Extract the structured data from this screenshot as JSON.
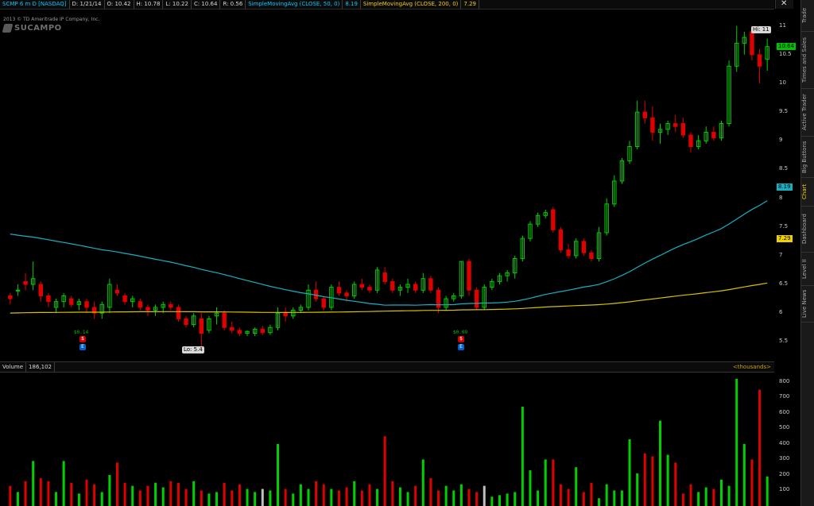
{
  "topbar": {
    "symbol": "SCMP 6 m D [NASDAQ]",
    "date": "D: 1/21/14",
    "open": "O: 10.42",
    "high": "H: 10.78",
    "low": "L: 10.22",
    "close": "C: 10.64",
    "range": "R: 0.56",
    "sma50_label": "SimpleMovingAvg (CLOSE, 50, 0)",
    "sma50_value": "8.19",
    "sma200_label": "SimpleMovingAvg (CLOSE, 200, 0)",
    "sma200_value": "7.29"
  },
  "copyright": "2013 © TD Ameritrade IP Company, Inc.",
  "logo_text": "SUCAMPO",
  "sidebar_tabs": [
    "Trade",
    "Times and Sales",
    "Active Trader",
    "Big Buttons",
    "Chart",
    "Dashboard",
    "Level II",
    "Live News"
  ],
  "price_axis": [
    "11",
    "10.5",
    "10",
    "9.5",
    "9",
    "8.5",
    "8",
    "7.5",
    "7",
    "6.5",
    "6",
    "5.5"
  ],
  "badges": {
    "last": "10.64",
    "sma50": "8.19",
    "sma200": "7.29"
  },
  "hi_label": "Hi: 11",
  "lo_label": "Lo: 5.4",
  "dividend_labels": [
    "$0.14",
    "$0.09"
  ],
  "volume_header": {
    "title": "Volume",
    "value": "186,102",
    "units": "<thousands>"
  },
  "volume_axis": [
    "800",
    "700",
    "600",
    "500",
    "400",
    "300",
    "200",
    "100"
  ],
  "colors": {
    "up": "#00d000",
    "down": "#e00000",
    "sma50": "#17b0c0",
    "sma200": "#d8c000",
    "neutral": "#bfbfbf"
  },
  "chart_data": {
    "type": "candlestick",
    "period": "6 m D",
    "ylim": [
      5.2,
      11.3
    ],
    "candles": [
      [
        6.3,
        6.35,
        6.15,
        6.25
      ],
      [
        6.4,
        6.5,
        6.3,
        6.4
      ],
      [
        6.55,
        6.7,
        6.4,
        6.5
      ],
      [
        6.5,
        6.9,
        6.4,
        6.6
      ],
      [
        6.5,
        6.55,
        6.2,
        6.3
      ],
      [
        6.3,
        6.35,
        6.1,
        6.2
      ],
      [
        6.1,
        6.25,
        6.0,
        6.2
      ],
      [
        6.2,
        6.35,
        6.1,
        6.3
      ],
      [
        6.25,
        6.3,
        6.1,
        6.15
      ],
      [
        6.15,
        6.25,
        6.05,
        6.2
      ],
      [
        6.2,
        6.25,
        6.0,
        6.1
      ],
      [
        6.1,
        6.2,
        5.9,
        6.0
      ],
      [
        6.0,
        6.2,
        5.9,
        6.15
      ],
      [
        6.1,
        6.6,
        6.0,
        6.5
      ],
      [
        6.4,
        6.5,
        6.3,
        6.35
      ],
      [
        6.3,
        6.35,
        6.15,
        6.2
      ],
      [
        6.2,
        6.3,
        6.1,
        6.25
      ],
      [
        6.2,
        6.25,
        6.05,
        6.1
      ],
      [
        6.1,
        6.15,
        5.95,
        6.05
      ],
      [
        6.05,
        6.15,
        5.95,
        6.1
      ],
      [
        6.1,
        6.2,
        6.0,
        6.15
      ],
      [
        6.15,
        6.2,
        6.05,
        6.1
      ],
      [
        6.1,
        6.15,
        5.85,
        5.9
      ],
      [
        5.9,
        5.95,
        5.75,
        5.8
      ],
      [
        5.8,
        6.0,
        5.75,
        5.95
      ],
      [
        5.9,
        6.0,
        5.4,
        5.65
      ],
      [
        5.7,
        5.95,
        5.65,
        5.9
      ],
      [
        5.95,
        6.1,
        5.8,
        6.0
      ],
      [
        6.0,
        6.05,
        5.7,
        5.75
      ],
      [
        5.75,
        5.85,
        5.65,
        5.7
      ],
      [
        5.7,
        5.75,
        5.6,
        5.65
      ],
      [
        5.65,
        5.7,
        5.6,
        5.68
      ],
      [
        5.65,
        5.75,
        5.6,
        5.72
      ],
      [
        5.72,
        5.78,
        5.62,
        5.66
      ],
      [
        5.66,
        5.8,
        5.62,
        5.75
      ],
      [
        5.75,
        6.1,
        5.7,
        6.0
      ],
      [
        6.0,
        6.1,
        5.85,
        5.95
      ],
      [
        5.95,
        6.1,
        5.9,
        6.05
      ],
      [
        6.05,
        6.15,
        6.0,
        6.1
      ],
      [
        6.1,
        6.5,
        6.05,
        6.4
      ],
      [
        6.4,
        6.55,
        6.2,
        6.25
      ],
      [
        6.25,
        6.3,
        6.05,
        6.1
      ],
      [
        6.1,
        6.5,
        6.05,
        6.45
      ],
      [
        6.45,
        6.55,
        6.3,
        6.35
      ],
      [
        6.35,
        6.4,
        6.2,
        6.3
      ],
      [
        6.3,
        6.55,
        6.25,
        6.5
      ],
      [
        6.5,
        6.6,
        6.4,
        6.45
      ],
      [
        6.45,
        6.5,
        6.35,
        6.4
      ],
      [
        6.4,
        6.8,
        6.35,
        6.75
      ],
      [
        6.7,
        6.8,
        6.5,
        6.55
      ],
      [
        6.55,
        6.6,
        6.35,
        6.4
      ],
      [
        6.4,
        6.5,
        6.3,
        6.45
      ],
      [
        6.45,
        6.6,
        6.35,
        6.5
      ],
      [
        6.5,
        6.55,
        6.35,
        6.4
      ],
      [
        6.4,
        6.7,
        6.35,
        6.6
      ],
      [
        6.6,
        6.65,
        6.35,
        6.4
      ],
      [
        6.4,
        6.45,
        6.0,
        6.1
      ],
      [
        6.1,
        6.3,
        6.05,
        6.25
      ],
      [
        6.25,
        6.35,
        6.2,
        6.3
      ],
      [
        6.3,
        6.9,
        6.25,
        6.9
      ],
      [
        6.9,
        6.95,
        6.3,
        6.4
      ],
      [
        6.4,
        6.45,
        6.05,
        6.1
      ],
      [
        6.1,
        6.5,
        6.05,
        6.45
      ],
      [
        6.45,
        6.6,
        6.4,
        6.55
      ],
      [
        6.55,
        6.7,
        6.5,
        6.65
      ],
      [
        6.65,
        6.75,
        6.55,
        6.7
      ],
      [
        6.7,
        7.0,
        6.6,
        6.95
      ],
      [
        6.95,
        7.35,
        6.9,
        7.3
      ],
      [
        7.3,
        7.6,
        7.25,
        7.55
      ],
      [
        7.55,
        7.75,
        7.5,
        7.7
      ],
      [
        7.7,
        7.8,
        7.65,
        7.75
      ],
      [
        7.8,
        7.85,
        7.4,
        7.45
      ],
      [
        7.45,
        7.5,
        7.05,
        7.1
      ],
      [
        7.1,
        7.2,
        6.95,
        7.0
      ],
      [
        7.0,
        7.3,
        6.95,
        7.25
      ],
      [
        7.25,
        7.3,
        7.0,
        7.05
      ],
      [
        7.05,
        7.1,
        6.9,
        6.95
      ],
      [
        6.95,
        7.5,
        6.9,
        7.4
      ],
      [
        7.4,
        8.0,
        7.35,
        7.9
      ],
      [
        7.9,
        8.4,
        7.85,
        8.3
      ],
      [
        8.3,
        8.7,
        8.25,
        8.65
      ],
      [
        8.65,
        9.0,
        8.6,
        8.9
      ],
      [
        8.9,
        9.7,
        8.85,
        9.5
      ],
      [
        9.5,
        9.7,
        9.3,
        9.4
      ],
      [
        9.4,
        9.6,
        9.0,
        9.15
      ],
      [
        9.15,
        9.3,
        8.95,
        9.2
      ],
      [
        9.2,
        9.35,
        9.1,
        9.3
      ],
      [
        9.3,
        9.45,
        9.15,
        9.25
      ],
      [
        9.3,
        9.4,
        9.05,
        9.1
      ],
      [
        9.1,
        9.15,
        8.8,
        8.9
      ],
      [
        8.9,
        9.1,
        8.85,
        9.0
      ],
      [
        9.0,
        9.25,
        8.95,
        9.15
      ],
      [
        9.15,
        9.25,
        9.0,
        9.05
      ],
      [
        9.05,
        9.35,
        9.0,
        9.3
      ],
      [
        9.3,
        10.4,
        9.25,
        10.3
      ],
      [
        10.3,
        11.0,
        10.2,
        10.7
      ],
      [
        10.7,
        10.9,
        10.5,
        10.8
      ],
      [
        10.9,
        11.0,
        10.4,
        10.5
      ],
      [
        10.5,
        10.6,
        10.0,
        10.3
      ],
      [
        10.42,
        10.78,
        10.22,
        10.64
      ]
    ],
    "volume_thousands": [
      130,
      90,
      160,
      290,
      180,
      160,
      90,
      290,
      150,
      80,
      170,
      140,
      90,
      200,
      280,
      150,
      130,
      100,
      130,
      150,
      120,
      160,
      150,
      110,
      160,
      100,
      80,
      90,
      150,
      100,
      140,
      110,
      90,
      110,
      100,
      400,
      110,
      80,
      140,
      110,
      160,
      140,
      110,
      100,
      120,
      160,
      100,
      140,
      110,
      450,
      160,
      120,
      90,
      130,
      300,
      180,
      100,
      130,
      100,
      140,
      110,
      90,
      130,
      60,
      70,
      80,
      90,
      640,
      230,
      100,
      300,
      300,
      140,
      110,
      250,
      90,
      150,
      50,
      140,
      100,
      100,
      430,
      210,
      340,
      320,
      550,
      330,
      280,
      80,
      140,
      90,
      120,
      110,
      170,
      130,
      820,
      400,
      300,
      750,
      190
    ]
  }
}
